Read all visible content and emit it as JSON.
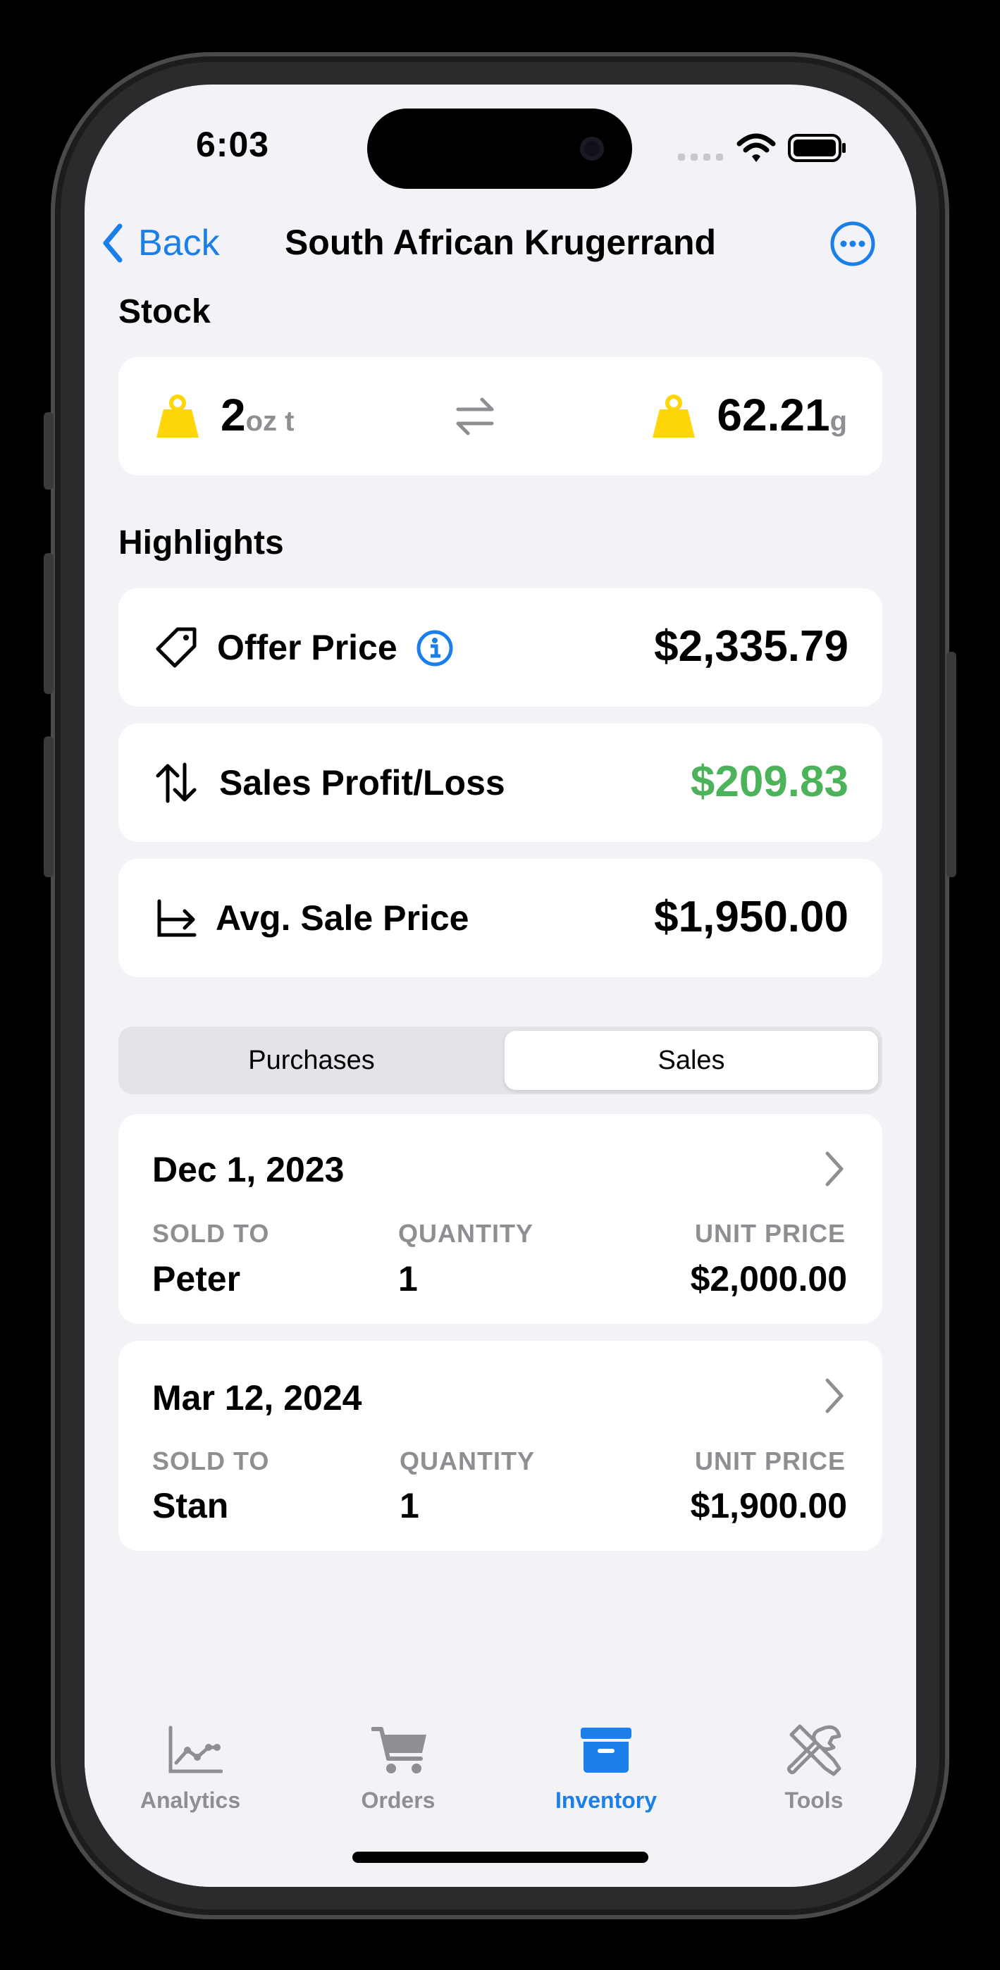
{
  "status_bar": {
    "time": "6:03"
  },
  "nav": {
    "back_label": "Back",
    "title": "South African Krugerrand"
  },
  "stock": {
    "section_title": "Stock",
    "left_value": "2",
    "left_unit": "oz t",
    "right_value": "62.21",
    "right_unit": "g",
    "weight_icon_color": "#FFD60A"
  },
  "highlights": {
    "section_title": "Highlights",
    "rows": [
      {
        "label": "Offer Price",
        "value": "$2,335.79",
        "icon": "tag-icon"
      },
      {
        "label": "Sales Profit/Loss",
        "value": "$209.83",
        "icon": "up-down-arrows-icon",
        "value_color": "#4CB35A"
      },
      {
        "label": "Avg. Sale Price",
        "value": "$1,950.00",
        "icon": "arrow-right-from-axis-icon"
      }
    ]
  },
  "segmented": {
    "options": [
      "Purchases",
      "Sales"
    ],
    "selected": "Sales"
  },
  "sales": [
    {
      "date": "Dec 1, 2023",
      "sold_to_caption": "SOLD TO",
      "sold_to": "Peter",
      "quantity_caption": "QUANTITY",
      "quantity": "1",
      "unit_price_caption": "UNIT PRICE",
      "unit_price": "$2,000.00"
    },
    {
      "date": "Mar 12, 2024",
      "sold_to_caption": "SOLD TO",
      "sold_to": "Stan",
      "quantity_caption": "QUANTITY",
      "quantity": "1",
      "unit_price_caption": "UNIT PRICE",
      "unit_price": "$1,900.00"
    }
  ],
  "tab_bar": {
    "tabs": [
      {
        "label": "Analytics",
        "icon": "chart-line-icon"
      },
      {
        "label": "Orders",
        "icon": "cart-icon"
      },
      {
        "label": "Inventory",
        "icon": "archive-box-icon"
      },
      {
        "label": "Tools",
        "icon": "tools-icon"
      }
    ],
    "selected": "Inventory"
  },
  "colors": {
    "accent": "#1A7FE8",
    "background": "#F2F2F7",
    "inactive": "#8E8E93"
  }
}
